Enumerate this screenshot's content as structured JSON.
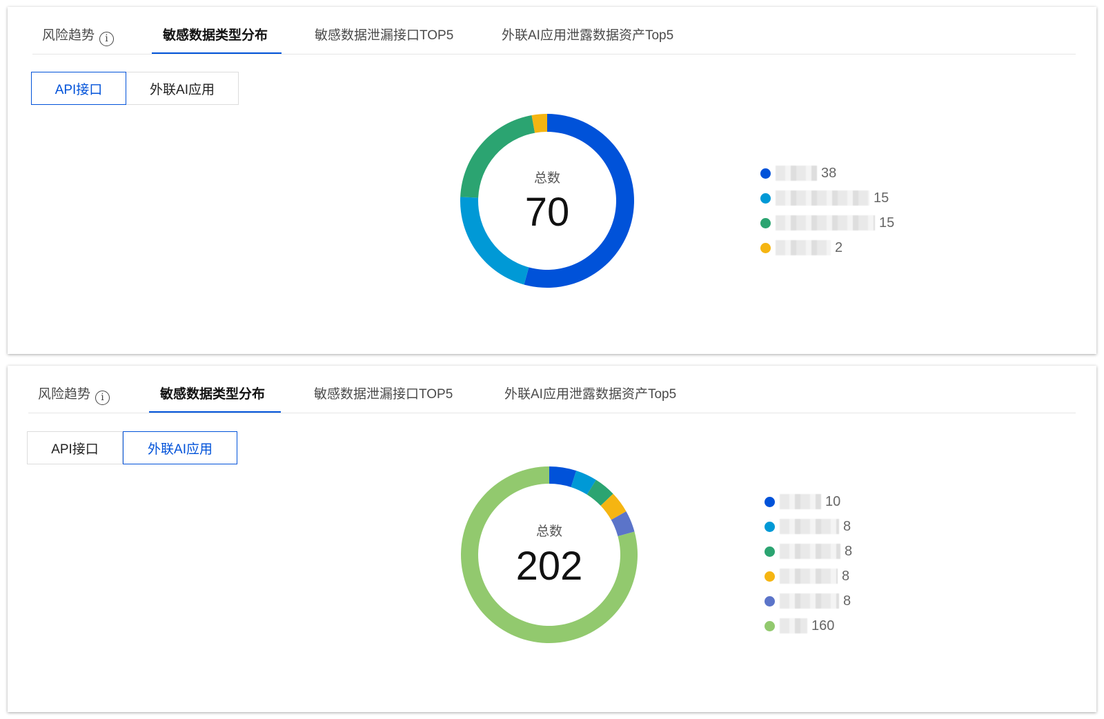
{
  "panels": [
    {
      "tabs": [
        {
          "label": "风险趋势",
          "has_info_icon": true,
          "active": false
        },
        {
          "label": "敏感数据类型分布",
          "has_info_icon": false,
          "active": true
        },
        {
          "label": "敏感数据泄漏接口TOP5",
          "has_info_icon": false,
          "active": false
        },
        {
          "label": "外联AI应用泄露数据资产Top5",
          "has_info_icon": false,
          "active": false
        }
      ],
      "segments": [
        {
          "label": "API接口",
          "selected": true
        },
        {
          "label": "外联AI应用",
          "selected": false
        }
      ],
      "donut": {
        "center_label": "总数",
        "total": "70"
      }
    },
    {
      "tabs": [
        {
          "label": "风险趋势",
          "has_info_icon": true,
          "active": false
        },
        {
          "label": "敏感数据类型分布",
          "has_info_icon": false,
          "active": true
        },
        {
          "label": "敏感数据泄漏接口TOP5",
          "has_info_icon": false,
          "active": false
        },
        {
          "label": "外联AI应用泄露数据资产Top5",
          "has_info_icon": false,
          "active": false
        }
      ],
      "segments": [
        {
          "label": "API接口",
          "selected": false
        },
        {
          "label": "外联AI应用",
          "selected": true
        }
      ],
      "donut": {
        "center_label": "总数",
        "total": "202"
      }
    }
  ],
  "info_icon": "info-circle-icon",
  "colors": {
    "accent": "#0052d9",
    "series": [
      "#0052d9",
      "#0099d6",
      "#2ba471",
      "#f5b512",
      "#5b74c9",
      "#92c96e"
    ]
  },
  "chart_data": [
    {
      "type": "pie",
      "variant": "donut",
      "total": 70,
      "legend_position": "right",
      "series": [
        {
          "value": 38,
          "color": "#0052d9"
        },
        {
          "value": 15,
          "color": "#0099d6"
        },
        {
          "value": 15,
          "color": "#2ba471"
        },
        {
          "value": 2,
          "color": "#f5b512"
        }
      ]
    },
    {
      "type": "pie",
      "variant": "donut",
      "total": 202,
      "legend_position": "right",
      "series": [
        {
          "value": 10,
          "color": "#0052d9"
        },
        {
          "value": 8,
          "color": "#0099d6"
        },
        {
          "value": 8,
          "color": "#2ba471"
        },
        {
          "value": 8,
          "color": "#f5b512"
        },
        {
          "value": 8,
          "color": "#5b74c9"
        },
        {
          "value": 160,
          "color": "#92c96e"
        }
      ]
    }
  ]
}
